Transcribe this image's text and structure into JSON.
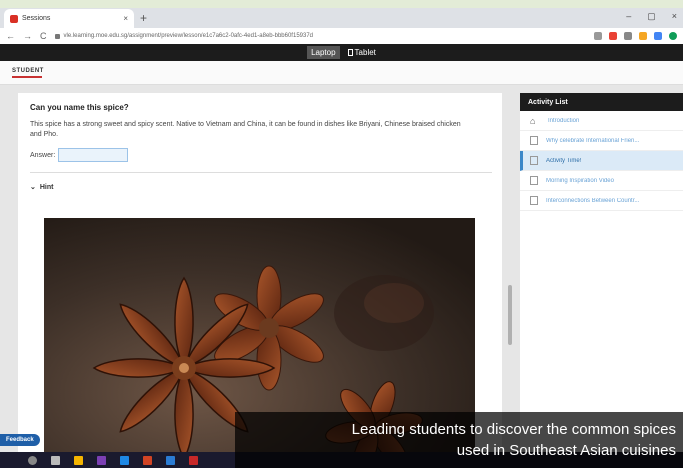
{
  "browser": {
    "tab_title": "Sessions",
    "tab_close": "×",
    "new_tab": "+",
    "window_controls": [
      "–",
      "▢",
      "×"
    ],
    "nav_back": "←",
    "nav_forward": "→",
    "nav_reload": "C",
    "url": "vle.learning.moe.edu.sg/assignment/preview/lesson/e1c7a6c2-0afc-4ed1-a8eb-bbb60f15937d"
  },
  "device_switch": {
    "laptop": "Laptop",
    "tablet": "Tablet"
  },
  "header": {
    "logo_text": "STUDENT"
  },
  "question": {
    "title": "Can you name this spice?",
    "description": "This spice has a strong sweet and spicy scent. Native to Vietnam and China, it can be found in dishes like Briyani, Chinese braised chicken and Pho.",
    "answer_label": "Answer:",
    "answer_value": "",
    "hint_label": "Hint",
    "hint_chevron": "⌄"
  },
  "activity_list": {
    "title": "Activity List",
    "items": [
      {
        "label": "Introduction",
        "icon": "home-icon"
      },
      {
        "label": "Why celebrate International Frien...",
        "icon": "document-icon"
      },
      {
        "label": "Activity Time!",
        "icon": "quiz-icon"
      },
      {
        "label": "Morning Inspiration Video",
        "icon": "video-icon"
      },
      {
        "label": "Interconnections Between Countr...",
        "icon": "document-icon"
      }
    ],
    "home_glyph": "⌂"
  },
  "feedback_label": "Feedback",
  "caption": {
    "line1": "Leading students to discover the common spices",
    "line2": "used in Southeast Asian cuisines"
  },
  "colors": {
    "accent": "#3b87c8",
    "link": "#6aa3d6",
    "feedback": "#1f5fa8",
    "frame": "#e3ecd7"
  }
}
